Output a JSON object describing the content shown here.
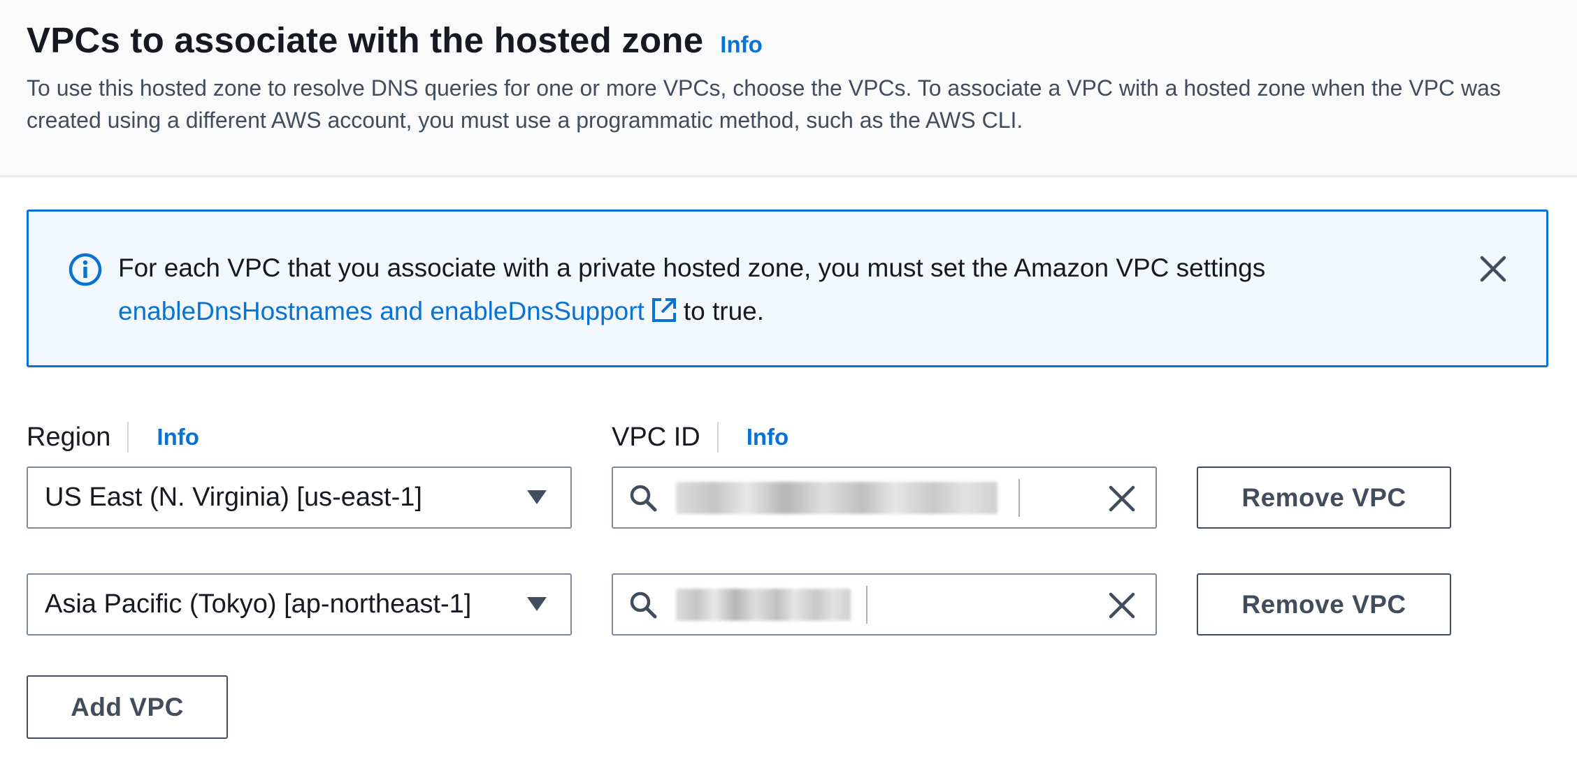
{
  "section": {
    "title": "VPCs to associate with the hosted zone",
    "info_label": "Info",
    "description": "To use this hosted zone to resolve DNS queries for one or more VPCs, choose the VPCs. To associate a VPC with a hosted zone when the VPC was created using a different AWS account, you must use a programmatic method, such as the AWS CLI."
  },
  "alert": {
    "text_before": "For each VPC that you associate with a private hosted zone, you must set the Amazon VPC settings ",
    "link_text": "enableDnsHostnames and enableDnsSupport",
    "text_after": "to true.",
    "icon": "info-circle-icon",
    "close_icon": "close-icon",
    "accent_color": "#0972d3",
    "background_color": "#f2f8fd"
  },
  "fields": {
    "region_label": "Region",
    "region_info": "Info",
    "vpc_id_label": "VPC ID",
    "vpc_id_info": "Info"
  },
  "rows": [
    {
      "region": "US East (N. Virginia) [us-east-1]",
      "vpc_id_redacted": true,
      "remove_label": "Remove VPC"
    },
    {
      "region": "Asia Pacific (Tokyo) [ap-northeast-1]",
      "vpc_id_redacted": true,
      "remove_label": "Remove VPC"
    }
  ],
  "add_vpc_label": "Add VPC"
}
